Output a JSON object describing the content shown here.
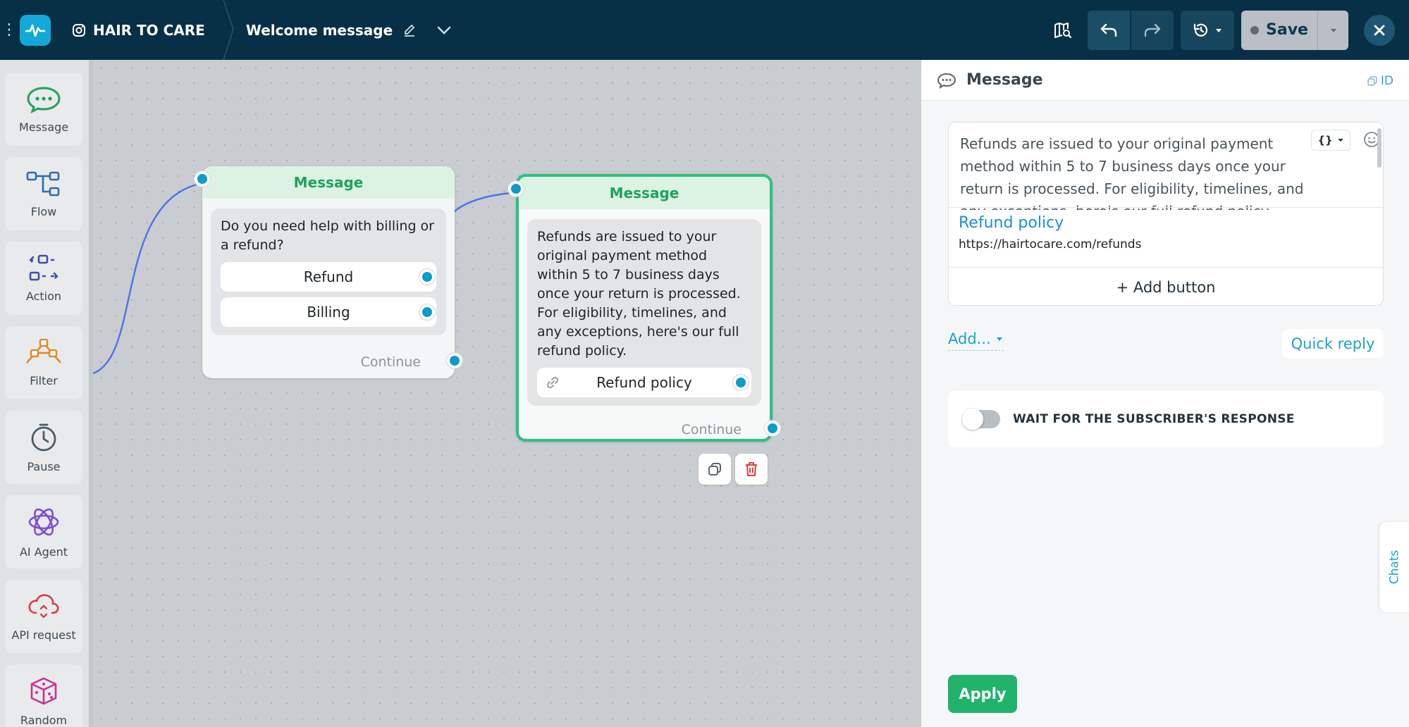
{
  "topbar": {
    "account_name": "HAIR TO CARE",
    "flow_title": "Welcome message",
    "save_label": "Save"
  },
  "toolbar": {
    "items": [
      {
        "label": "Message",
        "icon": "chat-bubble-icon",
        "color": "#22a35b"
      },
      {
        "label": "Flow",
        "icon": "flow-icon",
        "color": "#2a6db3"
      },
      {
        "label": "Action",
        "icon": "action-icon",
        "color": "#3f4fa8"
      },
      {
        "label": "Filter",
        "icon": "filter-icon",
        "color": "#e08a2c"
      },
      {
        "label": "Pause",
        "icon": "clock-icon",
        "color": "#4a5a66"
      },
      {
        "label": "AI Agent",
        "icon": "ai-agent-icon",
        "color": "#7a4fd1"
      },
      {
        "label": "API request",
        "icon": "api-cloud-icon",
        "color": "#d2414d"
      },
      {
        "label": "Random",
        "icon": "dice-icon",
        "color": "#c7348f"
      }
    ]
  },
  "canvas": {
    "node1": {
      "title": "Message",
      "text": "Do you need help with billing or a refund?",
      "buttons": [
        "Refund",
        "Billing"
      ],
      "continue_label": "Continue"
    },
    "node2": {
      "title": "Message",
      "text": "Refunds are issued to your original payment method within 5 to 7 business days once your return is processed. For eligibility, timelines, and any exceptions, here's our full refund policy.",
      "button": "Refund policy",
      "continue_label": "Continue"
    }
  },
  "panel": {
    "title": "Message",
    "id_label": "ID",
    "message_text": "Refunds are issued to your original payment method within 5 to 7 business days once your return is processed. For eligibility, timelines, and any exceptions, here's our full refund policy.",
    "variable_label": "{}",
    "link_title": "Refund policy",
    "link_url": "https://hairtocare.com/refunds",
    "add_button_label": "+ Add button",
    "add_label": "Add...",
    "quick_reply_label": "Quick reply",
    "wait_label": "WAIT FOR THE SUBSCRIBER'S RESPONSE",
    "apply_label": "Apply",
    "chats_label": "Chats"
  }
}
